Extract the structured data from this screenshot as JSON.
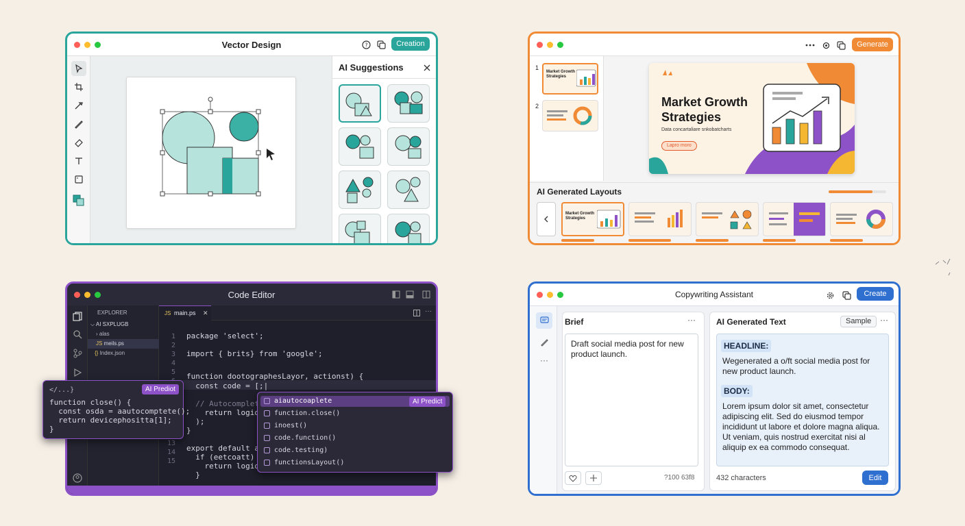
{
  "vector": {
    "title": "Vector Design",
    "creation_btn": "Creation",
    "ai_title": "AI Suggestions",
    "accent": "#2aa59b"
  },
  "slides": {
    "generate_btn": "Generate",
    "slide_nums": [
      "1",
      "2"
    ],
    "thumb_title": "Market Growth Strategies",
    "main_title_1": "Market Growth",
    "main_title_2": "Strategies",
    "main_sub": "Data concartaliare snkobatcharts",
    "main_btn": "Lapro moro",
    "layouts_title": "AI Generated Layouts",
    "layout_thumb_title": "Market Growth Strategies",
    "accent": "#f08a34"
  },
  "code": {
    "title": "Code Editor",
    "explorer": "EXPLORER",
    "tree": [
      "AI SXPLUGB",
      "alas",
      "meils.ps",
      "Index.json"
    ],
    "tab": "main.ps",
    "line_numbers": [
      "1",
      "2",
      "3",
      "4",
      "5",
      "6",
      "7",
      "8",
      "9",
      "10",
      "11",
      "12",
      "13",
      "14",
      "15"
    ],
    "lines": [
      "package 'select';",
      "import { brits} from 'google';",
      "function dootographesLayor, actionst) {",
      "  const code = [;|",
      "  // Autocomplete",
      "    return logios",
      "  );",
      "}",
      "export default aut",
      "  if (eetcoatt)",
      "    return logios",
      "  }"
    ],
    "popup_left": {
      "header": "</...}",
      "badge": "AI Prediot",
      "lines": [
        "function close() {",
        "  const osda = aautocomptete();",
        "  return devicephositta[1];",
        "}"
      ]
    },
    "popup_right": {
      "badge": "AI Predict",
      "items": [
        "aiautocoaplete",
        "function.close()",
        "inoest()",
        "code.function()",
        "code.testing)",
        "functionsLayout()"
      ]
    },
    "accent": "#8e52c8"
  },
  "copy": {
    "title": "Copywriting Assistant",
    "create_btn": "Create",
    "brief_title": "Brief",
    "brief_text": "Draft social media post for new product launch.",
    "brief_count": "?100 63f8",
    "gen_title": "AI Generated Text",
    "sample": "Sample",
    "headline_label": "HEADLINE:",
    "headline_text": "Wegenerated a o/ft social media post for new product launch.",
    "body_label": "BODY:",
    "body_text": "Lorem ipsum dolor sit amet, consectetur adipiscing elit. Sed do eiusmod tempor incididunt ut labore et dolore magna aliqua. Ut veniam, quis nostrud exercitat nisi al aliquip ex ea commodo consequat.",
    "chars": "432 characters",
    "edit": "Edit",
    "accent": "#2f6fd0"
  }
}
